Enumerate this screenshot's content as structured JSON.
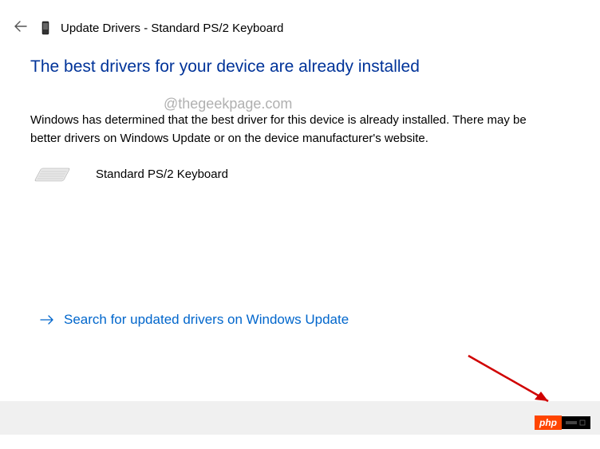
{
  "header": {
    "title": "Update Drivers - Standard PS/2 Keyboard"
  },
  "main": {
    "headline": "The best drivers for your device are already installed",
    "watermark": "@thegeekpage.com",
    "description": "Windows has determined that the best driver for this device is already installed. There may be better drivers on Windows Update or on the device manufacturer's website.",
    "device_name": "Standard PS/2 Keyboard",
    "link_text": "Search for updated drivers on Windows Update"
  },
  "badge": {
    "text": "php"
  }
}
